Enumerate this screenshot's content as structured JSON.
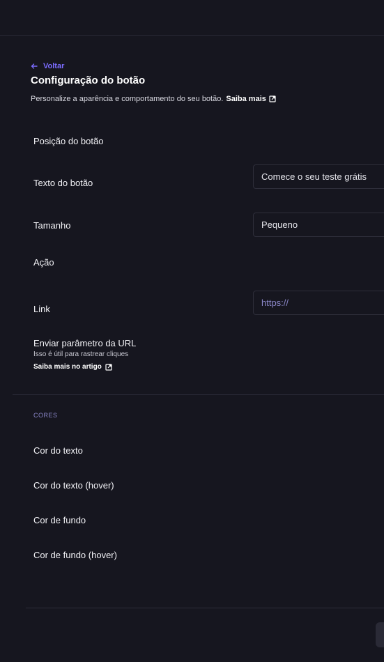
{
  "header": {
    "back_label": "Voltar",
    "title": "Configuração do botão",
    "subtitle": "Personalize a aparência e comportamento do seu botão.",
    "learn_more": "Saiba mais"
  },
  "form": {
    "position_label": "Posição do botão",
    "text_label": "Texto do botão",
    "text_value": "Comece o seu teste grátis",
    "size_label": "Tamanho",
    "size_value": "Pequeno",
    "action_label": "Ação",
    "link_label": "Link",
    "link_placeholder": "https://",
    "url_param_label": "Enviar parâmetro da URL",
    "url_param_hint": "Isso é útil para rastrear cliques",
    "url_param_article": "Saiba mais no artigo"
  },
  "colors_section": {
    "heading": "CORES",
    "text_color": "Cor do texto",
    "text_color_hover": "Cor do texto (hover)",
    "bg_color": "Cor de fundo",
    "bg_color_hover": "Cor de fundo (hover)"
  },
  "theme": {
    "background": "#16161f",
    "accent": "#7b6cff",
    "muted_accent": "#8b87c9",
    "border": "#2e2e3a"
  }
}
